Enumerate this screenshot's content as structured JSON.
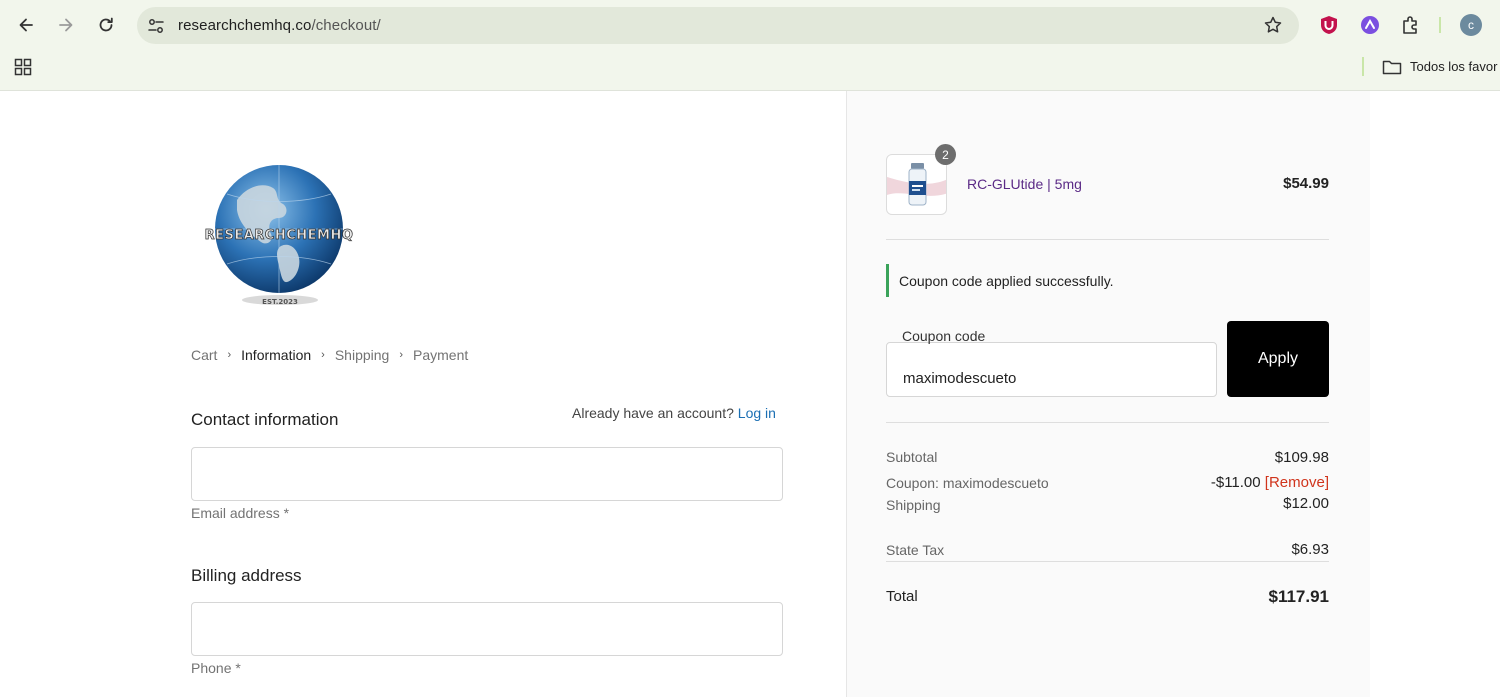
{
  "browser": {
    "url_domain": "researchchemhq.co",
    "url_path": "/checkout/",
    "profile_initial": "c",
    "bookmark_folder": "Todos los favor"
  },
  "breadcrumb": [
    {
      "label": "Cart"
    },
    {
      "label": "Information"
    },
    {
      "label": "Shipping"
    },
    {
      "label": "Payment"
    }
  ],
  "contact": {
    "title": "Contact information",
    "account_prompt": "Already have an account?",
    "login_label": "Log in",
    "email_label": "Email address *"
  },
  "billing": {
    "title": "Billing address",
    "phone_label": "Phone *"
  },
  "cart_item": {
    "name": "RC-GLUtide | 5mg",
    "quantity": "2",
    "price": "$54.99"
  },
  "notice": "Coupon code applied successfully.",
  "coupon": {
    "label": "Coupon code",
    "value": "maximodescueto",
    "apply_label": "Apply"
  },
  "totals": {
    "subtotal_label": "Subtotal",
    "subtotal": "$109.98",
    "coupon_label": "Coupon: maximodescueto",
    "coupon_amount": "-$11.00",
    "remove_label": "[Remove]",
    "shipping_label": "Shipping",
    "shipping": "$12.00",
    "tax_label": "State Tax",
    "tax": "$6.93",
    "total_label": "Total",
    "total": "$117.91"
  },
  "colors": {
    "accent_link": "#1b6fb3",
    "product_link": "#5b2a86",
    "remove": "#d0341c",
    "success": "#3aa35a",
    "button": "#000000"
  },
  "icons": [
    "back-icon",
    "forward-icon",
    "reload-icon",
    "site-settings-icon",
    "bookmark-star-icon",
    "shield-extension-icon",
    "purple-extension-icon",
    "puzzle-extensions-icon",
    "apps-grid-icon",
    "folder-icon",
    "chevron-right-icon"
  ]
}
